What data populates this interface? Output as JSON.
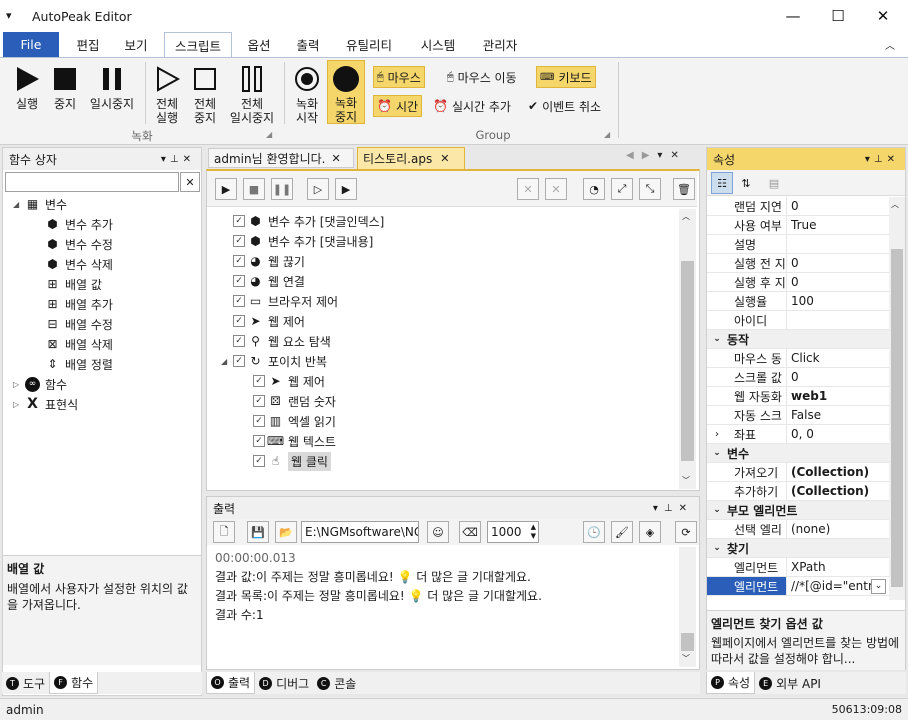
{
  "window": {
    "title": "AutoPeak Editor",
    "minimize": "—",
    "maximize": "☐",
    "close": "✕",
    "sysmenu": "▾"
  },
  "menu": {
    "file": "File",
    "items": [
      "편집",
      "보기",
      "스크립트",
      "옵션",
      "출력",
      "유틸리티",
      "시스템",
      "관리자"
    ],
    "active": "스크립트",
    "collapse": "︿"
  },
  "ribbon": {
    "run": "실행",
    "stop": "중지",
    "pause": "일시중지",
    "all_run": [
      "전체",
      "실행"
    ],
    "all_stop": [
      "전체",
      "중지"
    ],
    "all_pause": [
      "전체",
      "일시중지"
    ],
    "rec_start": [
      "녹화",
      "시작"
    ],
    "rec_stop": [
      "녹화",
      "중지"
    ],
    "group_record": "녹화",
    "group_group": "Group",
    "mouse": "마우스",
    "mouse_move": "마우스 이동",
    "keyboard": "키보드",
    "time": "시간",
    "realtime_add": "실시간 추가",
    "event_cancel": "이벤트 취소"
  },
  "left_panel": {
    "title": "함수 상자",
    "search_value": "",
    "tree": [
      {
        "label": "변수",
        "level": 0,
        "expander": "◢",
        "icon": "var-group-icon"
      },
      {
        "label": "변수 추가",
        "level": 1,
        "icon": "cube-icon"
      },
      {
        "label": "변수 수정",
        "level": 1,
        "icon": "cube-icon"
      },
      {
        "label": "변수 삭제",
        "level": 1,
        "icon": "cube-icon"
      },
      {
        "label": "배열 값",
        "level": 1,
        "icon": "array-icon"
      },
      {
        "label": "배열 추가",
        "level": 1,
        "icon": "array-add-icon"
      },
      {
        "label": "배열 수정",
        "level": 1,
        "icon": "array-edit-icon"
      },
      {
        "label": "배열 삭제",
        "level": 1,
        "icon": "array-delete-icon"
      },
      {
        "label": "배열 정렬",
        "level": 1,
        "icon": "sort-icon"
      },
      {
        "label": "함수",
        "level": 0,
        "expander": "▷",
        "icon": "function-icon"
      },
      {
        "label": "표현식",
        "level": 0,
        "expander": "▷",
        "icon": "expression-icon"
      }
    ],
    "desc_title": "배열 값",
    "desc_text": "배열에서 사용자가 설정한 위치의 값을 가져옵니다.",
    "tabs": [
      {
        "label": "도구",
        "badge": "T"
      },
      {
        "label": "함수",
        "badge": "F"
      }
    ]
  },
  "editor": {
    "tabs": [
      {
        "label": "admin님 환영합니다.",
        "active": false
      },
      {
        "label": "티스토리.aps",
        "active": true
      }
    ],
    "tree": [
      {
        "label": "변수 추가 [댓글인덱스]",
        "level": 0,
        "icon": "cube-icon"
      },
      {
        "label": "변수 추가 [댓글내용]",
        "level": 0,
        "icon": "cube-icon"
      },
      {
        "label": "웹 끊기",
        "level": 0,
        "icon": "globe-icon"
      },
      {
        "label": "웹 연결",
        "level": 0,
        "icon": "globe-icon"
      },
      {
        "label": "브라우저 제어",
        "level": 0,
        "icon": "browser-icon"
      },
      {
        "label": "웹 제어",
        "level": 0,
        "icon": "send-icon"
      },
      {
        "label": "웹 요소 탐색",
        "level": 0,
        "icon": "magnifier-icon"
      },
      {
        "label": "포이치 반복",
        "level": 0,
        "icon": "loop-icon",
        "expander": "◢"
      },
      {
        "label": "웹 제어",
        "level": 1,
        "icon": "send-icon"
      },
      {
        "label": "랜덤 숫자",
        "level": 1,
        "icon": "dice-icon"
      },
      {
        "label": "엑셀 읽기",
        "level": 1,
        "icon": "excel-icon"
      },
      {
        "label": "웹 텍스트",
        "level": 1,
        "icon": "keyboard-icon"
      },
      {
        "label": "웹 클릭",
        "level": 1,
        "icon": "click-icon",
        "selected": true
      }
    ]
  },
  "output": {
    "title": "출력",
    "path": "E:\\NGMsoftware\\NG",
    "number": "1000",
    "lines": [
      "00:00:00.013",
      "결과 값:이 주제는 정말 흥미롭네요! 💡 더 많은 글 기대할게요.",
      "결과 목록:이 주제는 정말 흥미롭네요! 💡 더 많은 글 기대할게요.",
      "결과 수:1"
    ],
    "tabs": [
      {
        "label": "출력",
        "badge": "O"
      },
      {
        "label": "디버그",
        "badge": "D"
      },
      {
        "label": "콘솔",
        "badge": "C"
      }
    ]
  },
  "properties": {
    "title": "속성",
    "rows": [
      {
        "type": "prop",
        "k": "랜덤 지연",
        "v": "0"
      },
      {
        "type": "prop",
        "k": "사용 여부",
        "v": "True"
      },
      {
        "type": "prop",
        "k": "설명",
        "v": ""
      },
      {
        "type": "prop",
        "k": "실행 전 지",
        "v": "0"
      },
      {
        "type": "prop",
        "k": "실행 후 지",
        "v": "0"
      },
      {
        "type": "prop",
        "k": "실행율",
        "v": "100"
      },
      {
        "type": "prop",
        "k": "아이디",
        "v": ""
      },
      {
        "type": "cat",
        "k": "동작"
      },
      {
        "type": "prop",
        "k": "마우스 동",
        "v": "Click"
      },
      {
        "type": "prop",
        "k": "스크롤 값",
        "v": "0"
      },
      {
        "type": "prop",
        "k": "웹 자동화",
        "v": "web1",
        "bold": true
      },
      {
        "type": "prop",
        "k": "자동 스크",
        "v": "False"
      },
      {
        "type": "prop",
        "k": "좌표",
        "v": "0, 0",
        "expander": true
      },
      {
        "type": "cat",
        "k": "변수"
      },
      {
        "type": "prop",
        "k": "가져오기",
        "v": "(Collection)",
        "bold": true
      },
      {
        "type": "prop",
        "k": "추가하기",
        "v": "(Collection)",
        "bold": true
      },
      {
        "type": "cat",
        "k": "부모 엘리먼트"
      },
      {
        "type": "prop",
        "k": "선택 엘리",
        "v": "(none)"
      },
      {
        "type": "cat",
        "k": "찾기"
      },
      {
        "type": "prop",
        "k": "엘리먼트",
        "v": "XPath"
      },
      {
        "type": "prop",
        "k": "엘리먼트",
        "v": "//*[@id=\"entr",
        "selected": true
      }
    ],
    "desc_title": "엘리먼트 찾기 옵션 값",
    "desc_text": "웹페이지에서 엘리먼트를 찾는 방법에 따라서 값을 설정해야 합니...",
    "tabs": [
      {
        "label": "속성",
        "badge": "P"
      },
      {
        "label": "외부 API",
        "badge": "E"
      }
    ]
  },
  "status": {
    "user": "admin",
    "time": "50613:09:08"
  },
  "colors": {
    "accent": "#2b5eb8",
    "highlight": "#f5d66b",
    "panel_head_active": "#f5d66b"
  }
}
